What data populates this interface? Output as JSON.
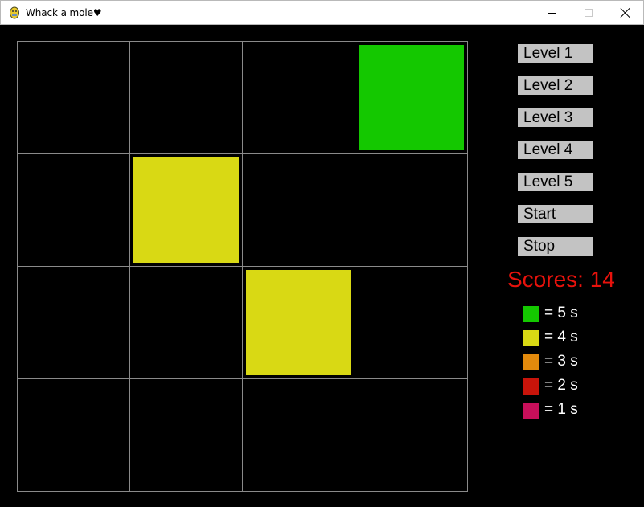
{
  "window": {
    "title": "Whack a mole♥",
    "icon": "pygame-snake-icon",
    "controls": {
      "minimize": "minimize-icon",
      "maximize": "maximize-icon",
      "close": "close-icon"
    }
  },
  "board": {
    "rows": 4,
    "cols": 4,
    "grid_color": "#8a8a8a",
    "moles": [
      {
        "row": 0,
        "col": 3,
        "seconds": 5
      },
      {
        "row": 1,
        "col": 1,
        "seconds": 4
      },
      {
        "row": 2,
        "col": 2,
        "seconds": 4
      }
    ]
  },
  "buttons": [
    {
      "label": "Level 1"
    },
    {
      "label": "Level 2"
    },
    {
      "label": "Level 3"
    },
    {
      "label": "Level 4"
    },
    {
      "label": "Level 5"
    },
    {
      "label": "Start"
    },
    {
      "label": "Stop"
    }
  ],
  "score": {
    "text": "Scores: 14",
    "color": "#e8120c"
  },
  "legend": [
    {
      "label": "= 5 s",
      "seconds": 5,
      "color": "#14c800"
    },
    {
      "label": "= 4 s",
      "seconds": 4,
      "color": "#d9d914"
    },
    {
      "label": "= 3 s",
      "seconds": 3,
      "color": "#e38a0c"
    },
    {
      "label": "= 2 s",
      "seconds": 2,
      "color": "#c8140a"
    },
    {
      "label": "= 1 s",
      "seconds": 1,
      "color": "#c80f5a"
    }
  ]
}
